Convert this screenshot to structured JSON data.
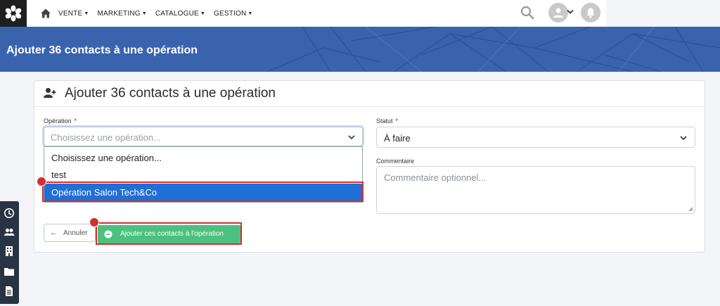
{
  "nav": {
    "menu": [
      "VENTE",
      "MARKETING",
      "CATALOGUE",
      "GESTION"
    ],
    "icons": [
      "logo",
      "home-icon",
      "search-icon",
      "user-icon",
      "bell-icon"
    ]
  },
  "banner": {
    "title": "Ajouter 36 contacts à une opération"
  },
  "card": {
    "title": "Ajouter 36 contacts à une opération",
    "operation": {
      "label": "Opération",
      "required": "*",
      "placeholder": "Choisissez une opération...",
      "options": [
        "Choisissez une opération...",
        "test",
        "Opération Salon Tech&Co"
      ],
      "highlighted_option": "Opération Salon Tech&Co"
    },
    "statut": {
      "label": "Statut",
      "required": "*",
      "value": "À faire"
    },
    "commentaire": {
      "label": "Commentaire",
      "placeholder": "Commentaire optionnel..."
    },
    "cancel_label": "Annuler",
    "submit_label": "Ajouter ces contacts à l'opération"
  },
  "colors": {
    "banner": "#3a63ad",
    "selected_option": "#1f6fd6",
    "submit_button": "#4cc17f",
    "annotation": "#d32f2f",
    "sidebar": "#2a3342"
  },
  "left_rail": {
    "icons": [
      "clock-icon",
      "users-icon",
      "building-icon",
      "folder-icon",
      "document-icon"
    ]
  }
}
